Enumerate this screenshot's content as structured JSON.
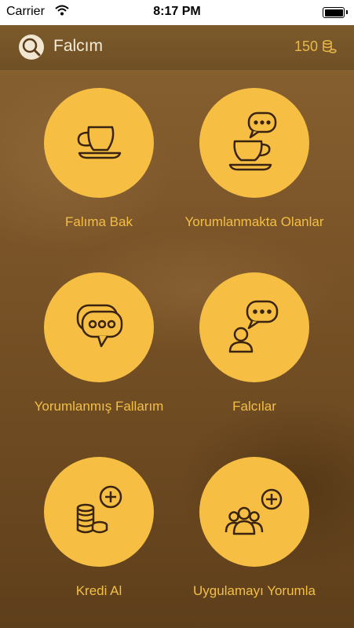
{
  "status": {
    "carrier": "Carrier",
    "time": "8:17 PM"
  },
  "navbar": {
    "title": "Falcım",
    "credits": "150",
    "credits_icon": "coins-icon",
    "logo_icon": "magnifier-logo-icon"
  },
  "menu": [
    {
      "label": "Falıma Bak",
      "icon": "cup-saucer-icon"
    },
    {
      "label": "Yorumlanmakta Olanlar",
      "icon": "cup-speech-bubble-icon"
    },
    {
      "label": "Yorumlanmış Fallarım",
      "icon": "double-speech-bubble-icon"
    },
    {
      "label": "Falcılar",
      "icon": "person-speech-bubble-icon"
    },
    {
      "label": "Kredi Al",
      "icon": "coins-plus-icon"
    },
    {
      "label": "Uygulamayı Yorumla",
      "icon": "group-plus-icon"
    }
  ],
  "colors": {
    "accent": "#f6bf44",
    "icon_stroke": "#3a2410",
    "label": "#f3bf47"
  }
}
